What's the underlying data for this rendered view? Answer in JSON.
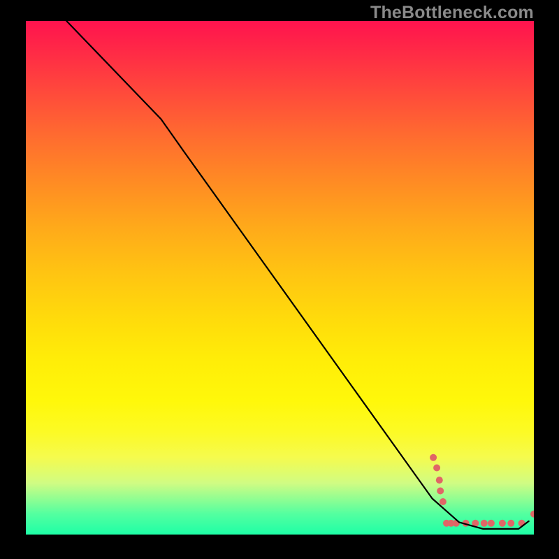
{
  "watermark": "TheBottleneck.com",
  "chart_data": {
    "type": "line",
    "title": "",
    "xlabel": "",
    "ylabel": "",
    "xlim": [
      0,
      100
    ],
    "ylim": [
      0,
      100
    ],
    "grid": false,
    "legend": false,
    "curve": {
      "color": "#000000",
      "points": [
        {
          "x": 8.0,
          "y": 100.0
        },
        {
          "x": 26.6,
          "y": 80.9
        },
        {
          "x": 31.1,
          "y": 74.6
        },
        {
          "x": 80.0,
          "y": 7.0
        },
        {
          "x": 85.3,
          "y": 2.4
        },
        {
          "x": 90.0,
          "y": 1.1
        },
        {
          "x": 97.0,
          "y": 1.1
        },
        {
          "x": 99.0,
          "y": 2.6
        }
      ]
    },
    "scatter": {
      "color": "#e06666",
      "points": [
        {
          "x": 80.2,
          "y": 15.0
        },
        {
          "x": 80.9,
          "y": 13.0
        },
        {
          "x": 81.4,
          "y": 10.6
        },
        {
          "x": 81.6,
          "y": 8.5
        },
        {
          "x": 82.1,
          "y": 6.4
        },
        {
          "x": 82.8,
          "y": 2.2
        },
        {
          "x": 83.7,
          "y": 2.2
        },
        {
          "x": 84.7,
          "y": 2.2
        },
        {
          "x": 86.6,
          "y": 2.2
        },
        {
          "x": 88.5,
          "y": 2.2
        },
        {
          "x": 90.2,
          "y": 2.2
        },
        {
          "x": 91.6,
          "y": 2.2
        },
        {
          "x": 93.8,
          "y": 2.2
        },
        {
          "x": 95.5,
          "y": 2.2
        },
        {
          "x": 97.6,
          "y": 2.2
        },
        {
          "x": 100.0,
          "y": 4.0
        }
      ]
    }
  }
}
